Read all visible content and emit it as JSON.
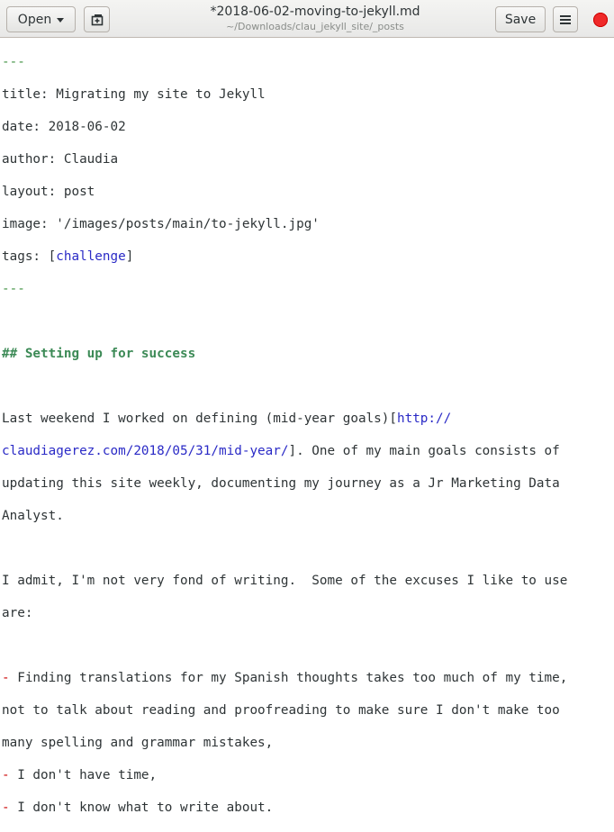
{
  "toolbar": {
    "open_label": "Open",
    "save_label": "Save"
  },
  "window": {
    "title": "*2018-06-02-moving-to-jekyll.md",
    "subtitle": "~/Downloads/clau_jekyll_site/_posts"
  },
  "colors": {
    "close": "#ef2929",
    "frontmatter_delim": "#3f9142",
    "heading": "#3c8a56",
    "link": "#2a2ac6",
    "list_marker": "#cc0000"
  },
  "document": {
    "fm_open": "---",
    "title_line": "title: Migrating my site to Jekyll",
    "date_line": "date: 2018-06-02",
    "author_line": "author: Claudia",
    "layout_line": "layout: post",
    "image_line": "image: '/images/posts/main/to-jekyll.jpg'",
    "tags_prefix": "tags: [",
    "tags_value": "challenge",
    "tags_suffix": "]",
    "fm_close": "---",
    "heading": "## Setting up for success",
    "p1_l1_text": "Last weekend I worked on defining (mid-year goals)[",
    "p1_l1_link": "ttp://",
    "p1_l1_link_h": "h",
    "p1_l2_link": "claudiagerez.com/2018/05/31/mid-year/",
    "p1_l2_text": "]. One of my main goals consists of",
    "p1_l3": "updating this site weekly, documenting my journey as a Jr Marketing Data",
    "p1_l4": "Analyst.",
    "p2_l1": "I admit, I'm not very fond of writing.  Some of the excuses I like to use",
    "p2_l2": "are:",
    "list_marker": "-",
    "li1_l1": " Finding translations for my Spanish thoughts takes too much of my time,",
    "li1_l2": "not to talk about reading and proofreading to make sure I don't make too",
    "li1_l3": "many spelling and grammar mistakes,",
    "li2": " I don't have time,",
    "li3": " I don't know what to write about."
  }
}
